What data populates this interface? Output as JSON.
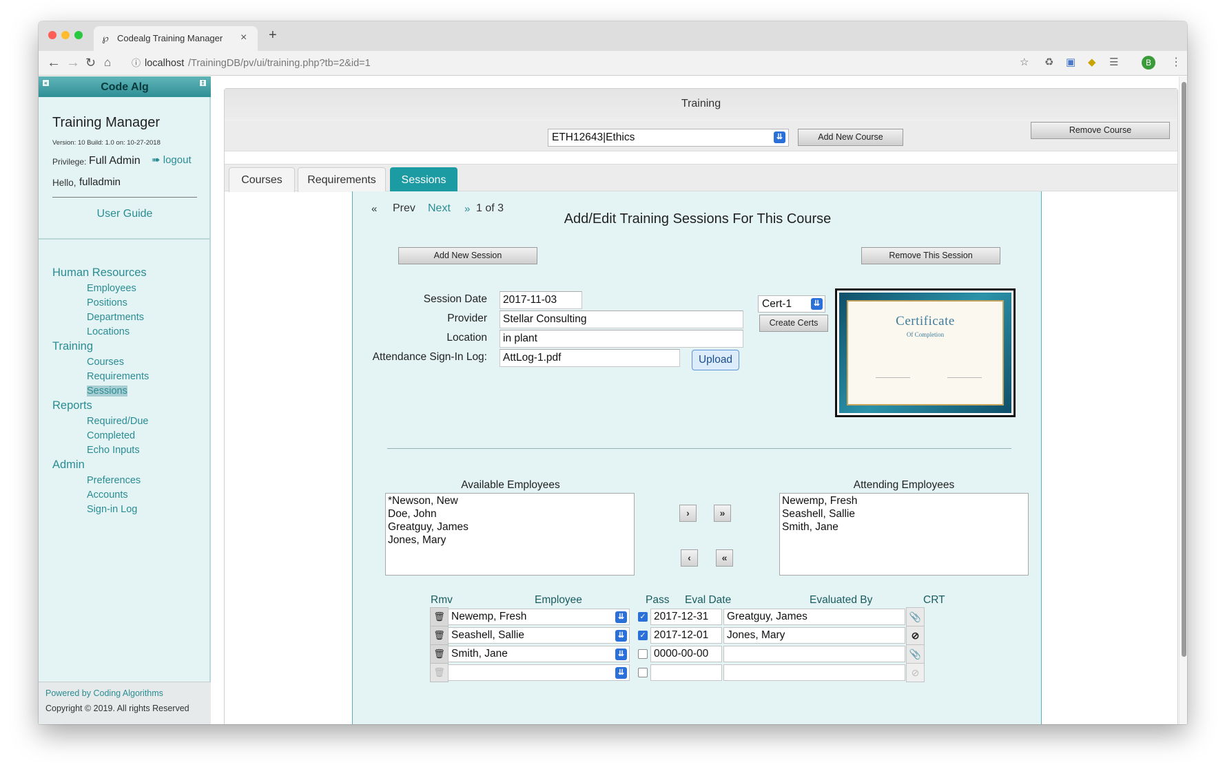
{
  "browser": {
    "tab_title": "Codealg Training Manager",
    "tab_close": "×",
    "new_tab": "+",
    "address_host": "localhost",
    "address_path": "/TrainingDB/pv/ui/training.php?tb=2&id=1",
    "profile_initial": "B"
  },
  "sidebar": {
    "brand": "Code Alg",
    "app_title": "Training Manager",
    "version": "Version: 10 Build: 1.0 on: 10-27-2018",
    "privilege_label": "Privilege:",
    "privilege_value": "Full Admin",
    "logout": "logout",
    "hello_label": "Hello,",
    "username": "fulladmin",
    "user_guide": "User Guide",
    "sections": [
      {
        "label": "Human Resources",
        "items": [
          "Employees",
          "Positions",
          "Departments",
          "Locations"
        ]
      },
      {
        "label": "Training",
        "items": [
          "Courses",
          "Requirements",
          "Sessions"
        ]
      },
      {
        "label": "Reports",
        "items": [
          "Required/Due",
          "Completed",
          "Echo Inputs"
        ]
      },
      {
        "label": "Admin",
        "items": [
          "Preferences",
          "Accounts",
          "Sign-in Log"
        ]
      }
    ],
    "active_item": "Sessions",
    "powered_by": "Powered by Coding Algorithms",
    "copyright": "Copyright © 2019. All rights Reserved"
  },
  "training": {
    "header": "Training",
    "course_select": "ETH12643|Ethics",
    "add_course": "Add New Course",
    "remove_course": "Remove Course",
    "tabs": [
      "Courses",
      "Requirements",
      "Sessions"
    ],
    "active_tab": "Sessions"
  },
  "session": {
    "pager": {
      "first": "«",
      "prev": "Prev",
      "next": "Next",
      "last": "»",
      "position": "1 of 3"
    },
    "title": "Add/Edit Training Sessions For This Course",
    "add_session": "Add New Session",
    "remove_session": "Remove This Session",
    "date_label": "Session Date",
    "date_value": "2017-11-03",
    "provider_label": "Provider",
    "provider_value": "Stellar Consulting",
    "location_label": "Location",
    "location_value": "in plant",
    "attendance_label": "Attendance Sign-In Log:",
    "attendance_value": "AttLog-1.pdf",
    "upload": "Upload",
    "cert_select": "Cert-1",
    "create_certs": "Create Certs",
    "certificate": {
      "title": "Certificate",
      "subtitle": "Of Completion"
    }
  },
  "employees": {
    "available_label": "Available Employees",
    "available": [
      "*Newson, New",
      "Doe, John",
      "Greatguy, James",
      "Jones, Mary"
    ],
    "attending_label": "Attending Employees",
    "attending": [
      "Newemp, Fresh",
      "Seashell, Sallie",
      "Smith, Jane"
    ],
    "move_one_right": "›",
    "move_all_right": "»",
    "move_one_left": "‹",
    "move_all_left": "«"
  },
  "results": {
    "headers": {
      "rmv": "Rmv",
      "employee": "Employee",
      "pass": "Pass",
      "eval_date": "Eval Date",
      "evaluated_by": "Evaluated By",
      "crt": "CRT"
    },
    "rows": [
      {
        "employee": "Newemp, Fresh",
        "pass": true,
        "eval_date": "2017-12-31",
        "evaluated_by": "Greatguy, James",
        "crt_icon": "paperclip-icon"
      },
      {
        "employee": "Seashell, Sallie",
        "pass": true,
        "eval_date": "2017-12-01",
        "evaluated_by": "Jones, Mary",
        "crt_icon": "ban-icon"
      },
      {
        "employee": "Smith, Jane",
        "pass": false,
        "eval_date": "0000-00-00",
        "evaluated_by": "",
        "crt_icon": "paperclip-icon"
      },
      {
        "employee": "",
        "pass": false,
        "eval_date": "",
        "evaluated_by": "",
        "crt_icon": "ban-icon"
      }
    ]
  },
  "colors": {
    "accent": "#1d9ba3",
    "panel": "#e4f4f4",
    "link": "#2a8c93"
  }
}
